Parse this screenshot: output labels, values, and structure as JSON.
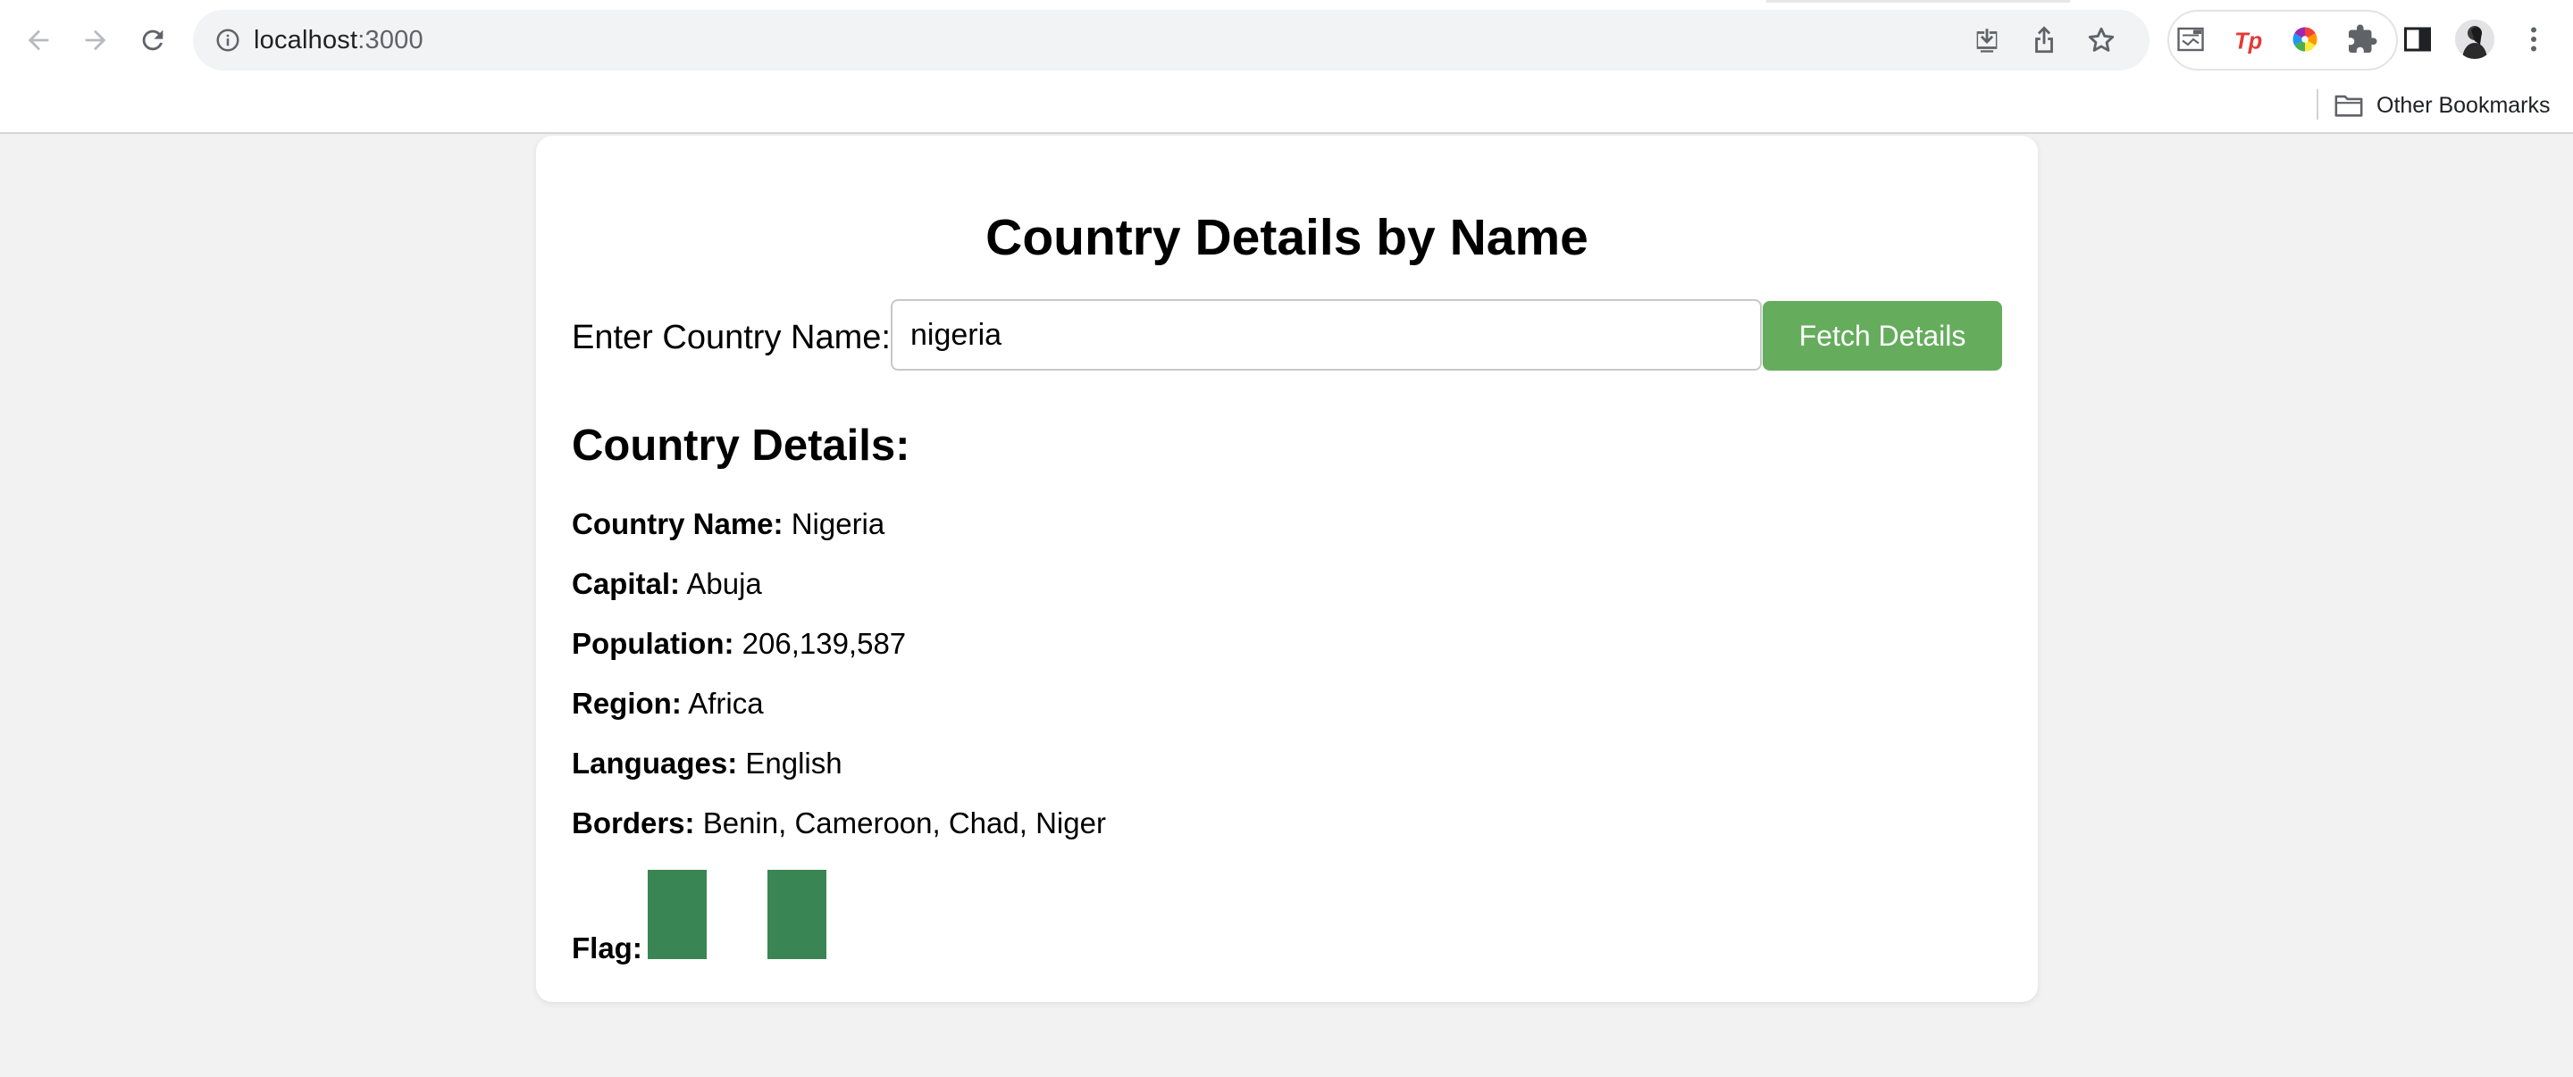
{
  "browser": {
    "url_host": "localhost",
    "url_port": ":3000",
    "bookmarks": {
      "other_label": "Other Bookmarks"
    },
    "extensions": [
      "screen-capture-icon",
      "tp-icon",
      "color-wheel-icon",
      "puzzle-icon"
    ]
  },
  "page": {
    "title": "Country Details by Name",
    "input_label": "Enter Country Name:",
    "input_value": "nigeria",
    "fetch_button": "Fetch Details",
    "details_heading": "Country Details:",
    "details": [
      {
        "label": "Country Name:",
        "value": "Nigeria"
      },
      {
        "label": "Capital:",
        "value": "Abuja"
      },
      {
        "label": "Population:",
        "value": "206,139,587"
      },
      {
        "label": "Region:",
        "value": "Africa"
      },
      {
        "label": "Languages:",
        "value": "English"
      },
      {
        "label": "Borders:",
        "value": "Benin, Cameroon, Chad, Niger"
      }
    ],
    "flag_label": "Flag:",
    "flag_colors": [
      "#3a8554",
      "#ffffff",
      "#3a8554"
    ]
  }
}
